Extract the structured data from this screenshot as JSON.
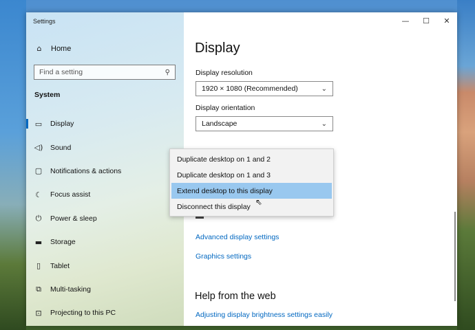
{
  "window": {
    "title": "Settings",
    "controls": {
      "minimize": "—",
      "maximize": "☐",
      "close": "✕"
    }
  },
  "sidebar": {
    "home_label": "Home",
    "search_placeholder": "Find a setting",
    "section_title": "System",
    "items": [
      {
        "label": "Display",
        "icon": "monitor-icon",
        "selected": true
      },
      {
        "label": "Sound",
        "icon": "speaker-icon"
      },
      {
        "label": "Notifications & actions",
        "icon": "notification-icon"
      },
      {
        "label": "Focus assist",
        "icon": "moon-icon"
      },
      {
        "label": "Power & sleep",
        "icon": "power-icon"
      },
      {
        "label": "Storage",
        "icon": "storage-icon"
      },
      {
        "label": "Tablet",
        "icon": "tablet-icon"
      },
      {
        "label": "Multi-tasking",
        "icon": "multitasking-icon"
      },
      {
        "label": "Projecting to this PC",
        "icon": "projector-icon"
      }
    ]
  },
  "main": {
    "page_title": "Display",
    "resolution": {
      "label": "Display resolution",
      "value": "1920 × 1080 (Recommended)"
    },
    "orientation": {
      "label": "Display orientation",
      "value": "Landscape"
    },
    "multiple_displays_menu": [
      "Duplicate desktop on 1 and 2",
      "Duplicate desktop on 1 and 3",
      "Extend desktop to this display",
      "Disconnect this display"
    ],
    "highlighted_option": "Extend desktop to this display",
    "links": {
      "advanced": "Advanced display settings",
      "graphics": "Graphics settings"
    },
    "help": {
      "title": "Help from the web",
      "link": "Adjusting display brightness settings easily"
    }
  },
  "colors": {
    "accent": "#0067c0",
    "menu_highlight": "#99c8ef"
  }
}
